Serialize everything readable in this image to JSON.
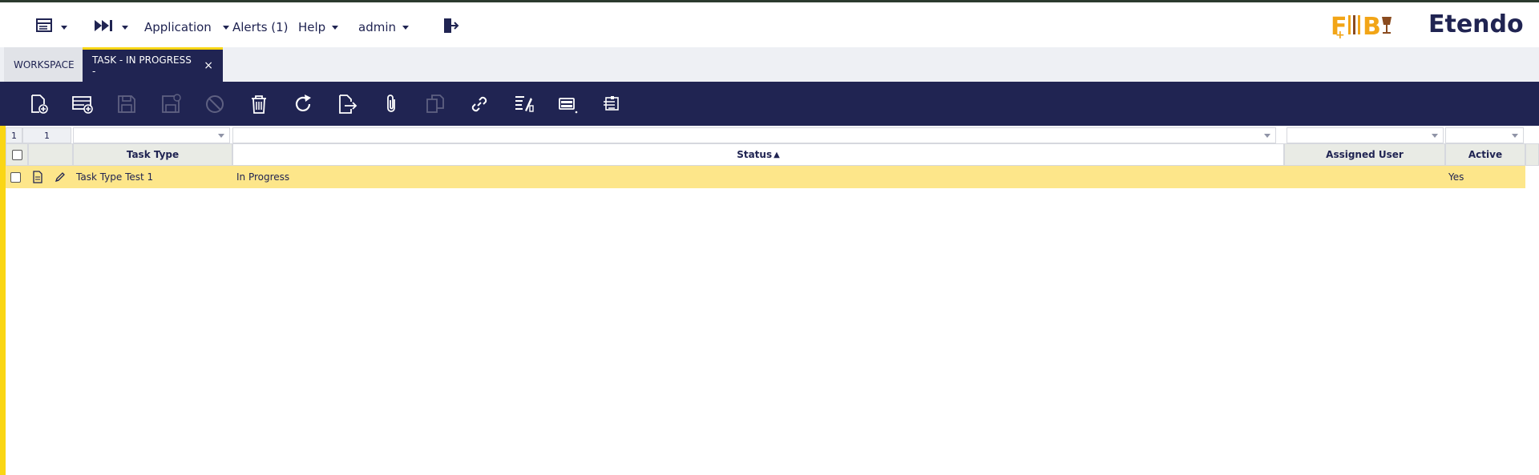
{
  "navbar": {
    "menu_icon": "menu-list-icon",
    "quick_launch_icon": "fast-forward-icon",
    "application_label": "Application",
    "alerts_label": "Alerts (1)",
    "help_label": "Help",
    "user_label": "admin",
    "logout_icon": "logout-icon",
    "brand_fb": "F B",
    "brand_etendo": "Etendo"
  },
  "tabs": [
    {
      "label": "WORKSPACE"
    },
    {
      "label": "TASK - IN PROGRESS -"
    }
  ],
  "toolbar": {
    "buttons": [
      {
        "name": "new-document-icon",
        "enabled": true
      },
      {
        "name": "new-row-icon",
        "enabled": true
      },
      {
        "name": "save-icon",
        "enabled": false
      },
      {
        "name": "save-close-icon",
        "enabled": false
      },
      {
        "name": "undo-icon",
        "enabled": false
      },
      {
        "name": "delete-icon",
        "enabled": true
      },
      {
        "name": "refresh-icon",
        "enabled": true
      },
      {
        "name": "export-icon",
        "enabled": true
      },
      {
        "name": "attach-icon",
        "enabled": true
      },
      {
        "name": "clone-icon",
        "enabled": false
      },
      {
        "name": "link-icon",
        "enabled": true
      },
      {
        "name": "audit-icon",
        "enabled": true
      },
      {
        "name": "grid-view-icon",
        "enabled": true
      },
      {
        "name": "print-icon",
        "enabled": true
      }
    ]
  },
  "grid": {
    "filter": {
      "selected_count": "1",
      "total_count": "1"
    },
    "columns": [
      "Task Type",
      "Status",
      "Assigned User",
      "Active"
    ],
    "sort_indicator": "▲",
    "rows": [
      {
        "task_type": "Task Type Test 1",
        "status": "In Progress",
        "assigned_user": "",
        "active": "Yes"
      }
    ]
  },
  "colors": {
    "navy": "#202452",
    "yellow_accent": "#fad614",
    "selected_row": "#fde68a",
    "header_bg": "#e9ebe5"
  }
}
